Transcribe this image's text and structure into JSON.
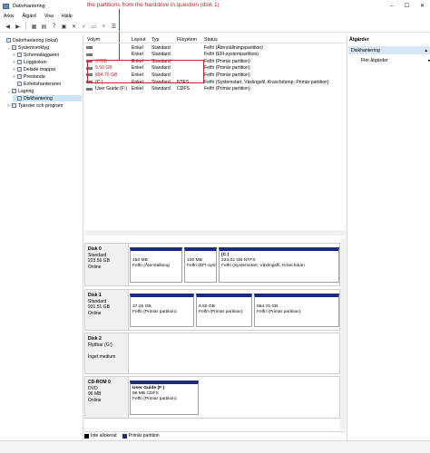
{
  "window": {
    "title": "Datorhantering",
    "controls": [
      "–",
      "☐",
      "✕"
    ]
  },
  "menu": [
    "Arkiv",
    "Åtgärd",
    "Visa",
    "Hjälp"
  ],
  "annotation": "the partitions from the harddrive in question (disk 1)",
  "tree": [
    {
      "label": "Datorhantering (lokal)",
      "indent": 0,
      "arrow": ""
    },
    {
      "label": "Systemverktyg",
      "indent": 1,
      "arrow": "⌄"
    },
    {
      "label": "Schemaläggaren",
      "indent": 2,
      "arrow": ">"
    },
    {
      "label": "Loggboken",
      "indent": 2,
      "arrow": ">"
    },
    {
      "label": "Delade mappar",
      "indent": 2,
      "arrow": ">"
    },
    {
      "label": "Prestanda",
      "indent": 2,
      "arrow": ">"
    },
    {
      "label": "Enhetshanteraren",
      "indent": 2,
      "arrow": ""
    },
    {
      "label": "Lagring",
      "indent": 1,
      "arrow": "⌄"
    },
    {
      "label": "Diskhantering",
      "indent": 2,
      "arrow": "",
      "selected": true
    },
    {
      "label": "Tjänster och program",
      "indent": 1,
      "arrow": ">"
    }
  ],
  "table": {
    "headers": [
      "Volym",
      "Layout",
      "Typ",
      "Filsystem",
      "Status"
    ],
    "rows": [
      {
        "volym": "",
        "layout": "Enkel",
        "typ": "Standard",
        "fs": "",
        "status": "Felfri (Återställningspartition)",
        "red": false
      },
      {
        "volym": "",
        "layout": "Enkel",
        "typ": "Standard",
        "fs": "",
        "status": "Felfri (EFI-systempartition)",
        "red": false
      },
      {
        "volym": "37GB",
        "layout": "Enkel",
        "typ": "Standard",
        "fs": "",
        "status": "Felfri (Primär partition)",
        "red": true
      },
      {
        "volym": "9.50 GB",
        "layout": "Enkel",
        "typ": "Standard",
        "fs": "",
        "status": "Felfri (Primär partition)",
        "red": true
      },
      {
        "volym": "884.76 GB",
        "layout": "Enkel",
        "typ": "Standard",
        "fs": "",
        "status": "Felfri (Primär partition)",
        "red": true
      },
      {
        "volym": "(C:)",
        "layout": "Enkel",
        "typ": "Standard",
        "fs": "NTFS",
        "status": "Felfri (Systemstart, Växlingsfil, Kraschdump, Primär partition)",
        "red": false
      },
      {
        "volym": "User Guide (F:)",
        "layout": "Enkel",
        "typ": "Standard",
        "fs": "CDFS",
        "status": "Felfri (Primär partition)",
        "red": false
      }
    ]
  },
  "actions": {
    "header": "Åtgärder",
    "section": "Diskhantering",
    "item": "Fler åtgärder"
  },
  "disks": [
    {
      "name": "Disk 0",
      "lines": [
        "Standard",
        "223.56 GB",
        "Online"
      ],
      "partitions": [
        {
          "lines": [
            "",
            "450 MB",
            "Felfri (Återställning"
          ]
        },
        {
          "lines": [
            "",
            "100 MB",
            "Felfri (EFI-syst"
          ]
        },
        {
          "lines": [
            "(C:)",
            "223.02 GB NTFS",
            "Felfri (Systemstart, Växlingsfil, Kraschdum"
          ]
        }
      ]
    },
    {
      "name": "Disk 1",
      "lines": [
        "Standard",
        "931.51 GB",
        "Online"
      ],
      "partitions": [
        {
          "lines": [
            "",
            "37.25 GB",
            "Felfri (Primär partition)"
          ]
        },
        {
          "lines": [
            "",
            "9.50 GB",
            "Felfri (Primär partition)"
          ]
        },
        {
          "lines": [
            "",
            "884.76 GB",
            "Felfri (Primär partition)"
          ]
        }
      ]
    },
    {
      "name": "Disk 2",
      "lines": [
        "Flyttbar (G:)",
        "",
        "Inget medium"
      ],
      "partitions": []
    },
    {
      "name": "CD-ROM 0",
      "lines": [
        "DVD",
        "96 MB",
        "Online"
      ],
      "partitions": [
        {
          "lines": [
            "User Guide  (F:)",
            "96 MB CDFS",
            "Felfri (Primär partition)"
          ]
        }
      ]
    }
  ],
  "legend": [
    {
      "label": "Inte allokerat",
      "color": "#000000"
    },
    {
      "label": "Primär partition",
      "color": "#1b2b7b"
    }
  ],
  "colors": {
    "partition_bar": "#1b2b7b",
    "annotation": "#c0262c",
    "selection": "#cce4f7"
  }
}
